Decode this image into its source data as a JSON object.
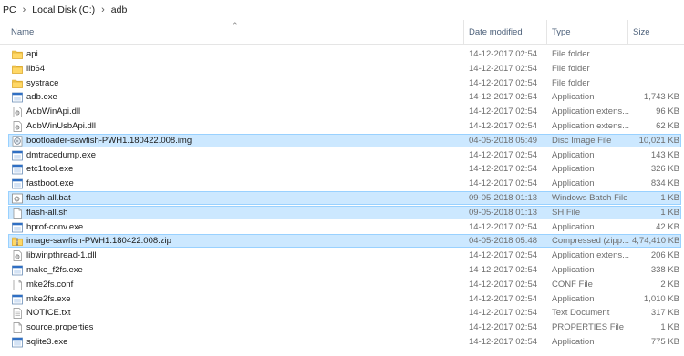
{
  "breadcrumb": {
    "items": [
      "PC",
      "Local Disk (C:)",
      "adb"
    ],
    "separator": "›"
  },
  "columns": {
    "name": "Name",
    "date_modified": "Date modified",
    "type": "Type",
    "size": "Size"
  },
  "colors": {
    "selection_bg": "#cce8ff",
    "selection_border": "#99d1ff",
    "header_text": "#4c607a",
    "secondary_text": "#6d6d6d"
  },
  "files": [
    {
      "name": "api",
      "date": "14-12-2017 02:54",
      "type": "File folder",
      "size": "",
      "icon": "folder-icon",
      "selected": false
    },
    {
      "name": "lib64",
      "date": "14-12-2017 02:54",
      "type": "File folder",
      "size": "",
      "icon": "folder-icon",
      "selected": false
    },
    {
      "name": "systrace",
      "date": "14-12-2017 02:54",
      "type": "File folder",
      "size": "",
      "icon": "folder-icon",
      "selected": false
    },
    {
      "name": "adb.exe",
      "date": "14-12-2017 02:54",
      "type": "Application",
      "size": "1,743 KB",
      "icon": "exe-icon",
      "selected": false
    },
    {
      "name": "AdbWinApi.dll",
      "date": "14-12-2017 02:54",
      "type": "Application extens...",
      "size": "96 KB",
      "icon": "dll-icon",
      "selected": false
    },
    {
      "name": "AdbWinUsbApi.dll",
      "date": "14-12-2017 02:54",
      "type": "Application extens...",
      "size": "62 KB",
      "icon": "dll-icon",
      "selected": false
    },
    {
      "name": "bootloader-sawfish-PWH1.180422.008.img",
      "date": "04-05-2018 05:49",
      "type": "Disc Image File",
      "size": "10,021 KB",
      "icon": "disc-image-icon",
      "selected": true
    },
    {
      "name": "dmtracedump.exe",
      "date": "14-12-2017 02:54",
      "type": "Application",
      "size": "143 KB",
      "icon": "exe-icon",
      "selected": false
    },
    {
      "name": "etc1tool.exe",
      "date": "14-12-2017 02:54",
      "type": "Application",
      "size": "326 KB",
      "icon": "exe-icon",
      "selected": false
    },
    {
      "name": "fastboot.exe",
      "date": "14-12-2017 02:54",
      "type": "Application",
      "size": "834 KB",
      "icon": "exe-icon",
      "selected": false
    },
    {
      "name": "flash-all.bat",
      "date": "09-05-2018 01:13",
      "type": "Windows Batch File",
      "size": "1 KB",
      "icon": "batch-file-icon",
      "selected": true
    },
    {
      "name": "flash-all.sh",
      "date": "09-05-2018 01:13",
      "type": "SH File",
      "size": "1 KB",
      "icon": "generic-file-icon",
      "selected": true
    },
    {
      "name": "hprof-conv.exe",
      "date": "14-12-2017 02:54",
      "type": "Application",
      "size": "42 KB",
      "icon": "exe-icon",
      "selected": false
    },
    {
      "name": "image-sawfish-PWH1.180422.008.zip",
      "date": "04-05-2018 05:48",
      "type": "Compressed (zipp...",
      "size": "4,74,410 KB",
      "icon": "zip-folder-icon",
      "selected": true
    },
    {
      "name": "libwinpthread-1.dll",
      "date": "14-12-2017 02:54",
      "type": "Application extens...",
      "size": "206 KB",
      "icon": "dll-icon",
      "selected": false
    },
    {
      "name": "make_f2fs.exe",
      "date": "14-12-2017 02:54",
      "type": "Application",
      "size": "338 KB",
      "icon": "exe-icon",
      "selected": false
    },
    {
      "name": "mke2fs.conf",
      "date": "14-12-2017 02:54",
      "type": "CONF File",
      "size": "2 KB",
      "icon": "generic-file-icon",
      "selected": false
    },
    {
      "name": "mke2fs.exe",
      "date": "14-12-2017 02:54",
      "type": "Application",
      "size": "1,010 KB",
      "icon": "exe-icon",
      "selected": false
    },
    {
      "name": "NOTICE.txt",
      "date": "14-12-2017 02:54",
      "type": "Text Document",
      "size": "317 KB",
      "icon": "text-file-icon",
      "selected": false
    },
    {
      "name": "source.properties",
      "date": "14-12-2017 02:54",
      "type": "PROPERTIES File",
      "size": "1 KB",
      "icon": "generic-file-icon",
      "selected": false
    },
    {
      "name": "sqlite3.exe",
      "date": "14-12-2017 02:54",
      "type": "Application",
      "size": "775 KB",
      "icon": "exe-icon",
      "selected": false
    }
  ]
}
